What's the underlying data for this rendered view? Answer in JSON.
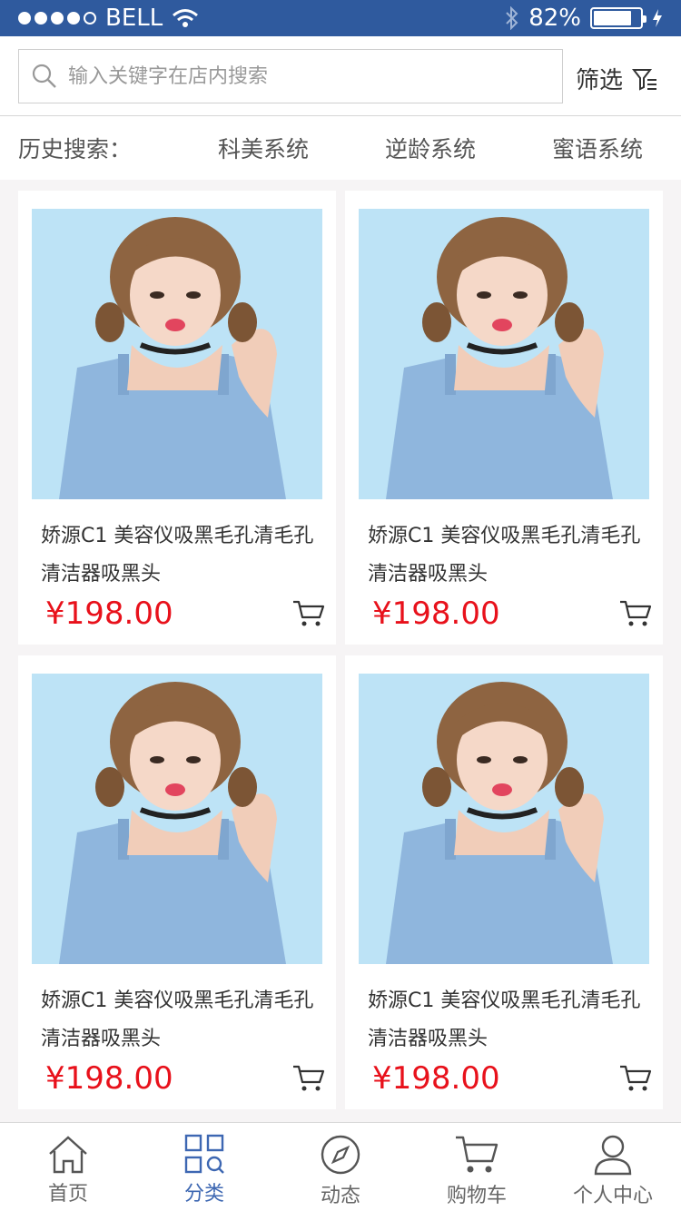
{
  "status": {
    "carrier": "BELL",
    "signal_bars_filled": 4,
    "signal_bars_total": 5,
    "battery_percent": "82%",
    "battery_level": 0.82
  },
  "search": {
    "placeholder": "输入关键字在店内搜索",
    "filter_label": "筛选"
  },
  "history": {
    "label": "历史搜索：",
    "items": [
      "科美系统",
      "逆龄系统",
      "蜜语系统"
    ]
  },
  "products": [
    {
      "title": "娇源C1 美容仪吸黑毛孔清毛孔清洁器吸黑头",
      "price": "¥198.00"
    },
    {
      "title": "娇源C1 美容仪吸黑毛孔清毛孔清洁器吸黑头",
      "price": "¥198.00"
    },
    {
      "title": "娇源C1 美容仪吸黑毛孔清毛孔清洁器吸黑头",
      "price": "¥198.00"
    },
    {
      "title": "娇源C1 美容仪吸黑毛孔清毛孔清洁器吸黑头",
      "price": "¥198.00"
    }
  ],
  "tabs": [
    {
      "label": "首页",
      "icon": "home-icon",
      "active": false
    },
    {
      "label": "分类",
      "icon": "category-icon",
      "active": true
    },
    {
      "label": "动态",
      "icon": "compass-icon",
      "active": false
    },
    {
      "label": "购物车",
      "icon": "cart-icon",
      "active": false
    },
    {
      "label": "个人中心",
      "icon": "user-icon",
      "active": false
    }
  ],
  "colors": {
    "status_bar": "#2f5a9e",
    "price": "#e8111b",
    "active_tab": "#3d67b2",
    "page_bg": "#f6f4f5"
  }
}
